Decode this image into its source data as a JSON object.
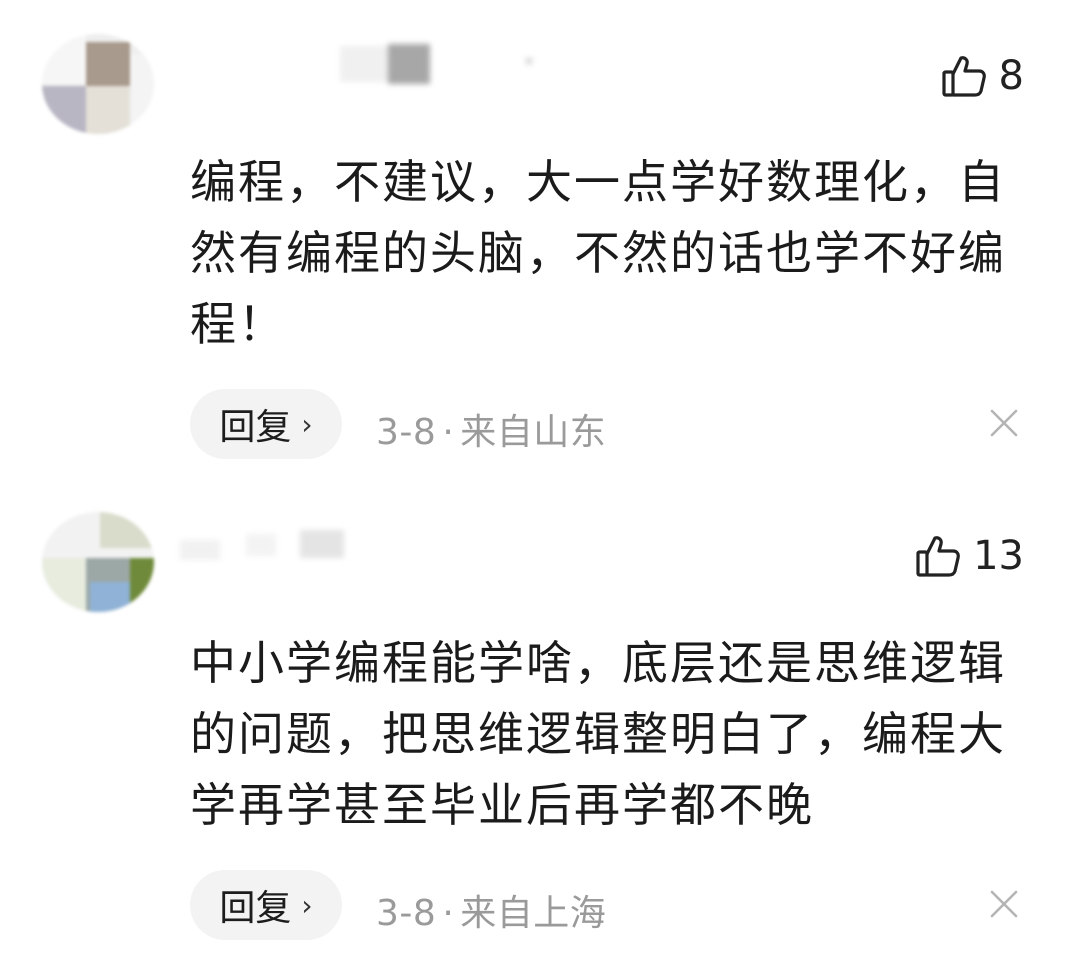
{
  "comments": [
    {
      "likes": "8",
      "text": "编程，不建议，大一点学好数理化，自然有编程的头脑，不然的话也学不好编程！",
      "reply_label": "回复",
      "date": "3-8",
      "separator": "·",
      "location": "来自山东",
      "icons": {
        "like": "thumbs-up-icon",
        "reply_arrow": "chevron-right-icon",
        "dismiss": "close-icon"
      }
    },
    {
      "likes": "13",
      "text": "中小学编程能学啥，底层还是思维逻辑的问题，把思维逻辑整明白了，编程大学再学甚至毕业后再学都不晚",
      "reply_label": "回复",
      "date": "3-8",
      "separator": "·",
      "location": "来自上海",
      "icons": {
        "like": "thumbs-up-icon",
        "reply_arrow": "chevron-right-icon",
        "dismiss": "close-icon"
      }
    }
  ],
  "colors": {
    "text": "#1b1b1b",
    "meta": "#9a9a9a",
    "reply_bg": "#f3f3f3",
    "icon": "#222222"
  }
}
